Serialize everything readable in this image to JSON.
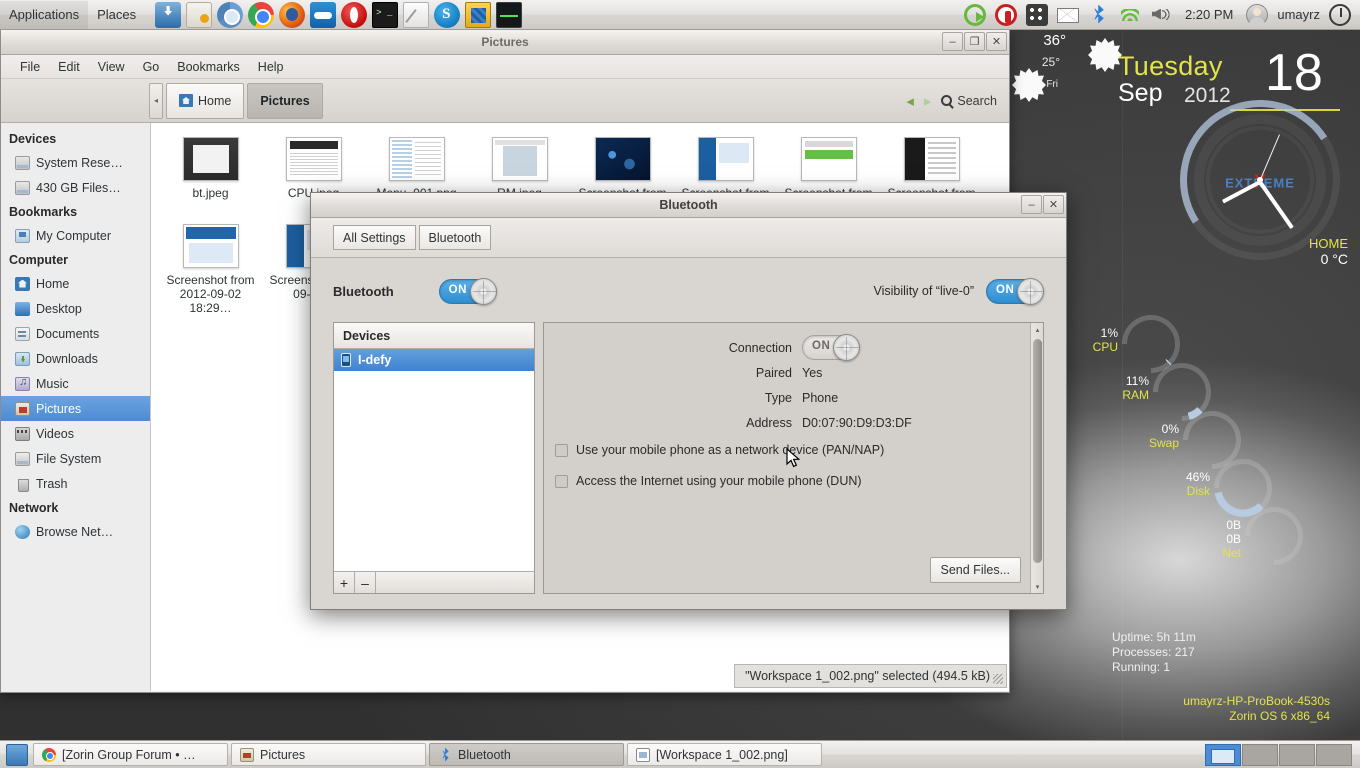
{
  "top_panel": {
    "menus": [
      "Applications",
      "Places"
    ],
    "launchers": [
      {
        "name": "download-manager-icon",
        "cls": "ic-dl"
      },
      {
        "name": "software-center-icon",
        "cls": "ic-store"
      },
      {
        "name": "chromium-icon",
        "cls": "ic-chromium"
      },
      {
        "name": "google-chrome-icon",
        "cls": "ic-chrome"
      },
      {
        "name": "firefox-icon",
        "cls": "ic-firefox"
      },
      {
        "name": "teamviewer-icon",
        "cls": "ic-tv"
      },
      {
        "name": "opera-icon",
        "cls": "ic-opera"
      },
      {
        "name": "terminal-icon",
        "cls": "ic-term"
      },
      {
        "name": "text-editor-icon",
        "cls": "ic-gedit"
      },
      {
        "name": "skype-icon",
        "cls": "ic-skype"
      },
      {
        "name": "workspace-switcher-icon",
        "cls": "ic-ws"
      },
      {
        "name": "system-monitor-icon",
        "cls": "ic-sysmon"
      }
    ],
    "tray": [
      {
        "name": "restart-icon",
        "cls": "tr-restart"
      },
      {
        "name": "shutdown-icon",
        "cls": "tr-shutdown"
      },
      {
        "name": "app-grid-icon",
        "cls": "tr-apps"
      },
      {
        "name": "mail-icon",
        "cls": "tr-mail"
      },
      {
        "name": "bluetooth-icon",
        "cls": "tr-bt"
      },
      {
        "name": "wifi-icon",
        "cls": "tr-wifi"
      },
      {
        "name": "volume-icon",
        "cls": "tr-vol"
      }
    ],
    "clock": "2:20 PM",
    "username": "umayrz"
  },
  "conky": {
    "weather": {
      "high": "36°",
      "low": "25°",
      "day": "Fri"
    },
    "date": {
      "weekday": "Tuesday",
      "month": "Sep",
      "year": "2012",
      "daynum": "18"
    },
    "clock_brand": "EXTREME",
    "clock_brand_x": "X",
    "home": {
      "label": "HOME",
      "value": "0 °C"
    },
    "gauges": [
      {
        "name": "cpu",
        "value": "1%",
        "label": "CPU",
        "pct": 1
      },
      {
        "name": "ram",
        "value": "11%",
        "label": "RAM",
        "pct": 11
      },
      {
        "name": "swap",
        "value": "0%",
        "label": "Swap",
        "pct": 0
      },
      {
        "name": "disk",
        "value": "46%",
        "label": "Disk",
        "pct": 46
      },
      {
        "name": "net",
        "value": "0B",
        "value2": "0B",
        "label": "Net",
        "pct": 0
      }
    ],
    "sysinfo": {
      "uptime": "Uptime: 5h 11m",
      "processes": "Processes: 217",
      "running": "Running: 1"
    },
    "host": {
      "hostname": "umayrz-HP-ProBook-4530s",
      "os": "Zorin OS 6  x86_64"
    }
  },
  "nautilus": {
    "title": "Pictures",
    "window_buttons": {
      "minimize": "–",
      "maximize": "❐",
      "close": "✕"
    },
    "menubar": [
      "File",
      "Edit",
      "View",
      "Go",
      "Bookmarks",
      "Help"
    ],
    "pathbar": {
      "collapse": "◂",
      "home": "Home",
      "current": "Pictures"
    },
    "nav": {
      "back": "◂",
      "forward": "▸"
    },
    "search_label": "Search",
    "sidebar": [
      {
        "type": "head",
        "label": "Devices"
      },
      {
        "type": "item",
        "label": "System Rese…",
        "icon": "drive",
        "name": "sidebar-item-system-reserved"
      },
      {
        "type": "item",
        "label": "430 GB Files…",
        "icon": "drive",
        "name": "sidebar-item-430gb-filesystem"
      },
      {
        "type": "head",
        "label": "Bookmarks"
      },
      {
        "type": "item",
        "label": "My Computer",
        "icon": "mycomp",
        "name": "sidebar-item-my-computer"
      },
      {
        "type": "head",
        "label": "Computer"
      },
      {
        "type": "item",
        "label": "Home",
        "icon": "home",
        "name": "sidebar-item-home"
      },
      {
        "type": "item",
        "label": "Desktop",
        "icon": "desktop",
        "name": "sidebar-item-desktop"
      },
      {
        "type": "item",
        "label": "Documents",
        "icon": "docs",
        "name": "sidebar-item-documents"
      },
      {
        "type": "item",
        "label": "Downloads",
        "icon": "dl",
        "name": "sidebar-item-downloads"
      },
      {
        "type": "item",
        "label": "Music",
        "icon": "music",
        "name": "sidebar-item-music"
      },
      {
        "type": "item",
        "label": "Pictures",
        "icon": "pics",
        "name": "sidebar-item-pictures",
        "selected": true
      },
      {
        "type": "item",
        "label": "Videos",
        "icon": "vids",
        "name": "sidebar-item-videos"
      },
      {
        "type": "item",
        "label": "File System",
        "icon": "fs",
        "name": "sidebar-item-file-system"
      },
      {
        "type": "item",
        "label": "Trash",
        "icon": "trash",
        "name": "sidebar-item-trash"
      },
      {
        "type": "head",
        "label": "Network"
      },
      {
        "type": "item",
        "label": "Browse Net…",
        "icon": "net",
        "name": "sidebar-item-browse-network"
      }
    ],
    "files": [
      {
        "label": "bt.jpeg",
        "thumb": "th-gray"
      },
      {
        "label": "CPU.jpeg",
        "thumb": "th-doc"
      },
      {
        "label": "Menu_001.png",
        "thumb": "th-menu"
      },
      {
        "label": "RM.jpeg",
        "thumb": "th-doc2"
      },
      {
        "label": "Screenshot from 2012",
        "thumb": "th-blue"
      },
      {
        "label": "Screenshot from 2012",
        "thumb": "th-win"
      },
      {
        "label": "Screenshot from 2012",
        "thumb": "th-green"
      },
      {
        "label": "Screenshot from 2012",
        "thumb": "th-split"
      },
      {
        "label": "Screenshot from 2012-09-02 18:29…",
        "thumb": "th-win2"
      },
      {
        "label": "Screenshot from 09-03 2",
        "thumb": "th-win"
      },
      {
        "label": "Workspace 1_002.png",
        "thumb": "th-gray",
        "selected": true
      }
    ],
    "status": "\"Workspace 1_002.png\" selected (494.5 kB)"
  },
  "bluetooth": {
    "title": "Bluetooth",
    "window_buttons": {
      "minimize": "–",
      "close": "✕"
    },
    "toolbar": [
      {
        "label": "All Settings",
        "name": "all-settings-button"
      },
      {
        "label": "Bluetooth",
        "name": "bluetooth-tab-button"
      }
    ],
    "power_label": "Bluetooth",
    "power_state": "ON",
    "visibility_label": "Visibility of “live-0”",
    "visibility_state": "ON",
    "devices_header": "Devices",
    "devices": [
      {
        "label": "I-defy",
        "selected": true
      }
    ],
    "device_buttons": {
      "add": "+",
      "remove": "–"
    },
    "details": [
      {
        "key": "Connection",
        "value": "",
        "toggle": "ON"
      },
      {
        "key": "Paired",
        "value": "Yes"
      },
      {
        "key": "Type",
        "value": "Phone"
      },
      {
        "key": "Address",
        "value": "D0:07:90:D9:D3:DF"
      }
    ],
    "checkboxes": [
      {
        "label": "Use your mobile phone as a network device (PAN/NAP)",
        "checked": false,
        "name": "pan-nap-checkbox"
      },
      {
        "label": "Access the Internet using your mobile phone (DUN)",
        "checked": false,
        "name": "dun-checkbox"
      }
    ],
    "send_files_label": "Send Files...",
    "scroll": {
      "up": "▴",
      "down": "▾"
    }
  },
  "bottom_panel": {
    "tasks": [
      {
        "label": "[Zorin Group Forum • …",
        "icon": "chrome",
        "active": false,
        "name": "taskbar-item-zorin-forum"
      },
      {
        "label": "Pictures",
        "icon": "folder",
        "active": false,
        "name": "taskbar-item-pictures"
      },
      {
        "label": "Bluetooth",
        "icon": "bt",
        "active": true,
        "name": "taskbar-item-bluetooth"
      },
      {
        "label": "[Workspace 1_002.png]",
        "icon": "img",
        "active": false,
        "name": "taskbar-item-workspace-image"
      }
    ],
    "workspaces": [
      {
        "active": true
      },
      {
        "active": false
      },
      {
        "active": false
      },
      {
        "active": false
      }
    ]
  },
  "colors": {
    "accent_blue": "#4d8bd4",
    "toggle_on": "#2e8ed0",
    "conky_yellow": "#e3e34a",
    "panel_bg": "#e4e2e0"
  }
}
